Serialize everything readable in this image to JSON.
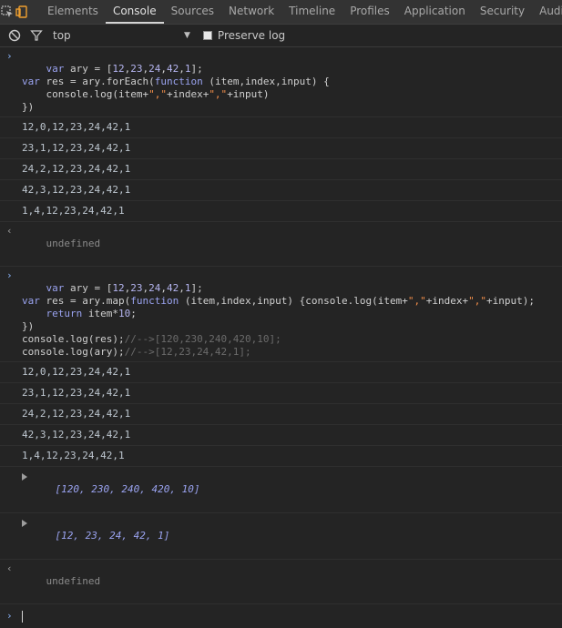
{
  "tabs": [
    "Elements",
    "Console",
    "Sources",
    "Network",
    "Timeline",
    "Profiles",
    "Application",
    "Security",
    "Audits"
  ],
  "toolbar": {
    "context": "top",
    "preserve_log": "Preserve log"
  },
  "block1": {
    "code": [
      [
        "var",
        " ary = [",
        "12",
        ",",
        "23",
        ",",
        "24",
        ",",
        "42",
        ",",
        "1",
        "];"
      ],
      [
        "var",
        " res = ary.forEach(",
        "function",
        " (item,index,input) {"
      ],
      [
        "    console.log(item+",
        "\",\"",
        "+index+",
        "\",\"",
        "+input)"
      ],
      [
        "})"
      ]
    ],
    "logs": [
      "12,0,12,23,24,42,1",
      "23,1,12,23,24,42,1",
      "24,2,12,23,24,42,1",
      "42,3,12,23,24,42,1",
      "1,4,12,23,24,42,1"
    ],
    "result": "undefined"
  },
  "block2": {
    "code": [
      [
        "var",
        " ary = [",
        "12",
        ",",
        "23",
        ",",
        "24",
        ",",
        "42",
        ",",
        "1",
        "];"
      ],
      [
        "var",
        " res = ary.map(",
        "function",
        " (item,index,input) {console.log(item+",
        "\",\"",
        "+index+",
        "\",\"",
        "+input);"
      ],
      [
        "    ",
        "return",
        " item*",
        "10",
        ";"
      ],
      [
        "})"
      ],
      [
        "console.log(res);",
        "//-->[120,230,240,420,10];"
      ],
      [
        "console.log(ary);",
        "//-->[12,23,24,42,1];"
      ]
    ],
    "logs": [
      "12,0,12,23,24,42,1",
      "23,1,12,23,24,42,1",
      "24,2,12,23,24,42,1",
      "42,3,12,23,24,42,1",
      "1,4,12,23,24,42,1"
    ],
    "arrays": [
      "[120, 230, 240, 420, 10]",
      "[12, 23, 24, 42, 1]"
    ],
    "result": "undefined"
  },
  "icons": {
    "inspect": "inspect-element-icon",
    "device": "device-mode-icon",
    "clear": "clear-console-icon",
    "filter": "filter-icon",
    "dropdown": "chevron-down-icon",
    "prompt": "prompt-chevron-icon"
  },
  "colors": {
    "background": "#242424",
    "tabbar": "#333333",
    "keyword": "#9aa3f0",
    "string": "#f08d49",
    "accent_prompt": "#8ab4f8"
  }
}
